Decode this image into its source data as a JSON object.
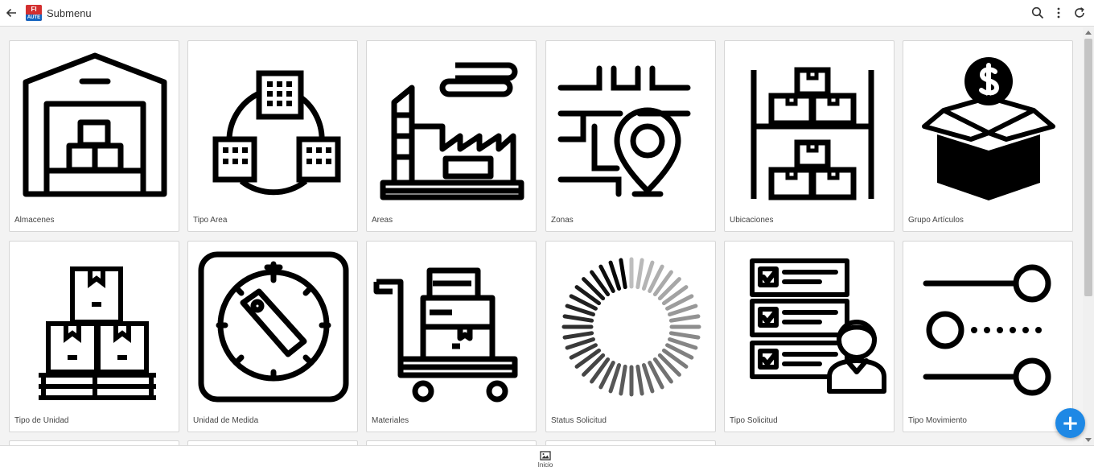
{
  "app": {
    "title": "Submenu",
    "logo_text_top": "FI",
    "logo_text_bottom": "AUTE"
  },
  "toolbar": {
    "back_icon": "arrow-left-icon",
    "search_icon": "search-icon",
    "more_icon": "more-vertical-icon",
    "refresh_icon": "refresh-icon"
  },
  "tiles": [
    {
      "label": "Almacenes",
      "icon": "warehouse-icon"
    },
    {
      "label": "Tipo Area",
      "icon": "buildings-network-icon"
    },
    {
      "label": "Areas",
      "icon": "factory-icon"
    },
    {
      "label": "Zonas",
      "icon": "location-map-icon"
    },
    {
      "label": "Ubicaciones",
      "icon": "shelving-boxes-icon"
    },
    {
      "label": "Grupo Artículos",
      "icon": "money-box-icon"
    },
    {
      "label": "Tipo de Unidad",
      "icon": "pallet-boxes-icon"
    },
    {
      "label": "Unidad de Medida",
      "icon": "measure-dial-icon"
    },
    {
      "label": "Materiales",
      "icon": "hand-truck-icon"
    },
    {
      "label": "Status Solicitud",
      "icon": "loading-spinner-icon"
    },
    {
      "label": "Tipo Solicitud",
      "icon": "checklist-person-icon"
    },
    {
      "label": "Tipo Movimiento",
      "icon": "slider-nodes-icon"
    }
  ],
  "fab": {
    "icon": "plus-icon",
    "color": "#1e88e5"
  },
  "bottom_nav": {
    "home_label": "Inicio",
    "home_icon": "image-icon"
  }
}
